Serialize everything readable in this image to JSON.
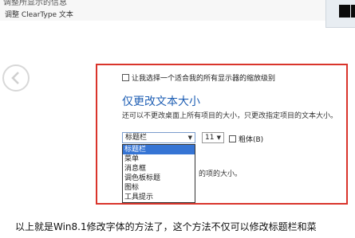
{
  "top": {
    "cut_text": "调整所显示的信息",
    "link_text": "调整 ClearType 文本"
  },
  "nav": {
    "back_icon": "chevron-left-icon"
  },
  "panel": {
    "scale_checkbox_label": "让我选择一个适合我的所有显示器的缩放级别",
    "heading": "仅更改文本大小",
    "description": "还可以不更改桌面上所有项目的大小，只更改指定项目的文本大小。",
    "item_select_value": "标题栏",
    "size_select_value": "11",
    "bold_label": "粗体(B)",
    "after_dropdown_text": "的项的大小。",
    "dropdown_options": [
      "标题栏",
      "菜单",
      "消息框",
      "调色板标题",
      "图标",
      "工具提示"
    ],
    "selected_option_index": 0
  },
  "caption": "以上就是Win8.1修改字体的方法了，这个方法不仅可以修改标题栏和菜"
}
